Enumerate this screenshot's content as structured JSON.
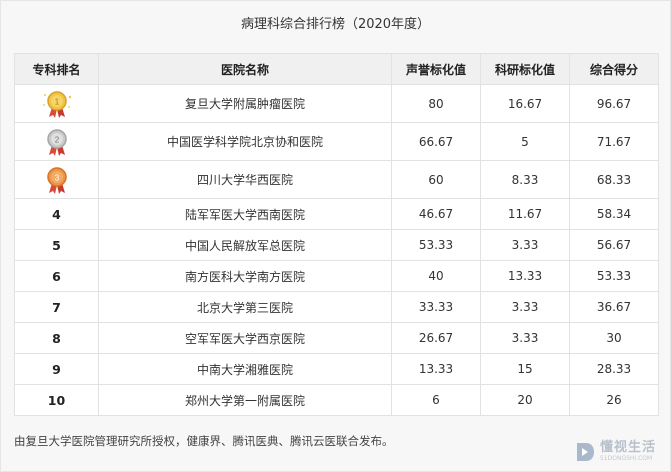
{
  "title": "病理科综合排行榜（2020年度）",
  "headers": [
    "专科排名",
    "医院名称",
    "声誉标化值",
    "科研标化值",
    "综合得分"
  ],
  "rows": [
    {
      "rank": "1",
      "hospital": "复旦大学附属肿瘤医院",
      "reputation": "80",
      "research": "16.67",
      "score": "96.67"
    },
    {
      "rank": "2",
      "hospital": "中国医学科学院北京协和医院",
      "reputation": "66.67",
      "research": "5",
      "score": "71.67"
    },
    {
      "rank": "3",
      "hospital": "四川大学华西医院",
      "reputation": "60",
      "research": "8.33",
      "score": "68.33"
    },
    {
      "rank": "4",
      "hospital": "陆军军医大学西南医院",
      "reputation": "46.67",
      "research": "11.67",
      "score": "58.34"
    },
    {
      "rank": "5",
      "hospital": "中国人民解放军总医院",
      "reputation": "53.33",
      "research": "3.33",
      "score": "56.67"
    },
    {
      "rank": "6",
      "hospital": "南方医科大学南方医院",
      "reputation": "40",
      "research": "13.33",
      "score": "53.33"
    },
    {
      "rank": "7",
      "hospital": "北京大学第三医院",
      "reputation": "33.33",
      "research": "3.33",
      "score": "36.67"
    },
    {
      "rank": "8",
      "hospital": "空军军医大学西京医院",
      "reputation": "26.67",
      "research": "3.33",
      "score": "30"
    },
    {
      "rank": "9",
      "hospital": "中南大学湘雅医院",
      "reputation": "13.33",
      "research": "15",
      "score": "28.33"
    },
    {
      "rank": "10",
      "hospital": "郑州大学第一附属医院",
      "reputation": "6",
      "research": "20",
      "score": "26"
    }
  ],
  "medal_colors": {
    "gold": "#e8b73a",
    "silver": "#b8b8b8",
    "bronze": "#e9893a",
    "ribbon": "#d84a3a"
  },
  "footer": "由复旦大学医院管理研究所授权，健康界、腾讯医典、腾讯云医联合发布。",
  "brand": {
    "name": "懂视生活",
    "url": "51DONGSHI.COM",
    "color": "#b9c1cc"
  }
}
